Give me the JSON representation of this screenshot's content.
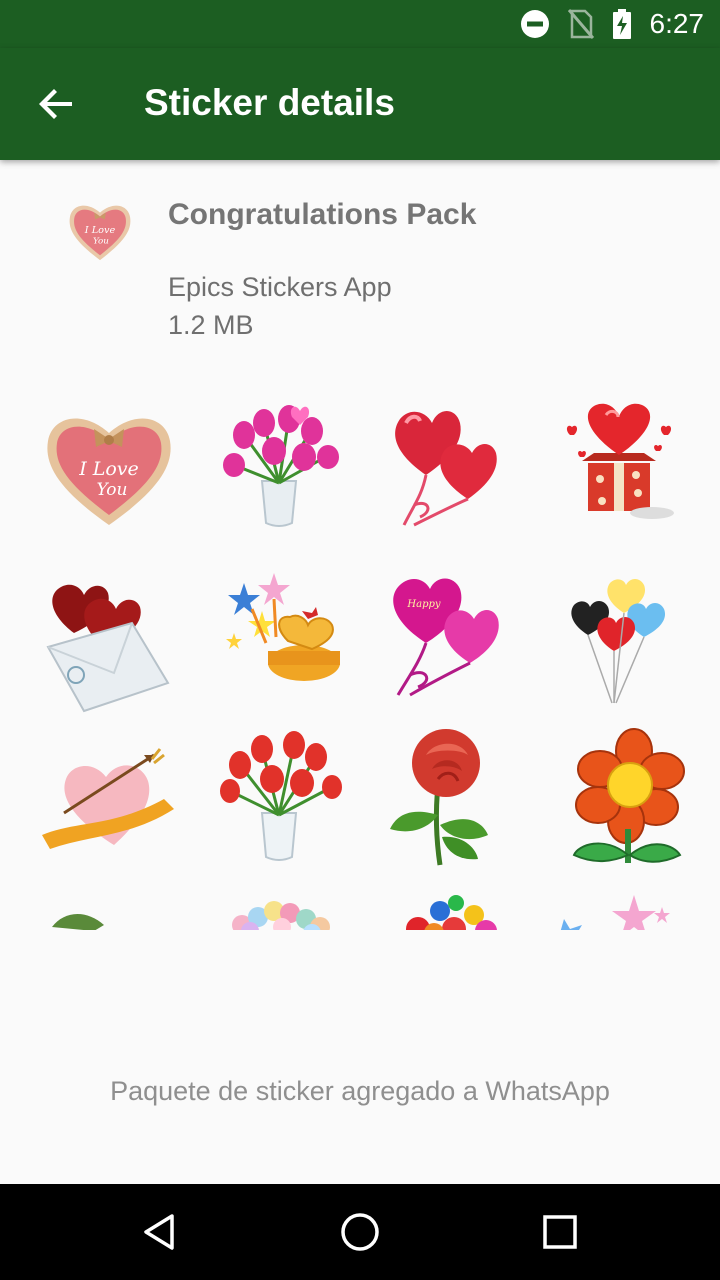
{
  "status_bar": {
    "time": "6:27",
    "icons": [
      "do-not-disturb-icon",
      "no-sim-icon",
      "battery-charging-icon"
    ]
  },
  "app_bar": {
    "title": "Sticker details",
    "back_icon": "arrow-back-icon"
  },
  "pack": {
    "name": "Congratulations Pack",
    "publisher": "Epics Stickers App",
    "size": "1.2 MB",
    "tray_icon": "i-love-you-heart",
    "tray_text_1": "I Love",
    "tray_text_2": "You"
  },
  "stickers": [
    "i-love-you-heart",
    "pink-tulips-vase",
    "red-heart-balloons",
    "hearts-gift-box",
    "hearts-envelope",
    "stars-heart-box",
    "valentine-balloons",
    "colorful-heart-balloons",
    "heart-arrow-ribbon",
    "red-tulips-vase",
    "red-rose",
    "orange-flower",
    "leaf-partial",
    "balloons-cluster",
    "balloons-bunch",
    "stars-partial"
  ],
  "footer": {
    "message": "Paquete de sticker agregado a WhatsApp"
  },
  "nav": {
    "icons": [
      "back-triangle-icon",
      "home-circle-icon",
      "recents-square-icon"
    ]
  },
  "colors": {
    "primary": "#1c5e22",
    "background": "#fafafa",
    "text_secondary": "#757575"
  }
}
